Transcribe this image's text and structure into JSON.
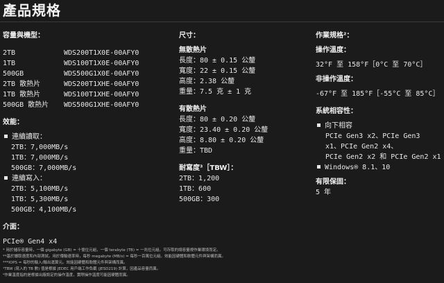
{
  "page_title": "產品規格",
  "capacity_model": {
    "heading": "容量與機型：",
    "rows": [
      {
        "capacity": "2TB",
        "model": "WDS200T1X0E-00AFY0"
      },
      {
        "capacity": "1TB",
        "model": "WDS100T1X0E-00AFY0"
      },
      {
        "capacity": "500GB",
        "model": "WDS500G1X0E-00AFY0"
      },
      {
        "capacity": "2TB 散熱片",
        "model": "WDS200T1XHE-00AFY0"
      },
      {
        "capacity": "1TB 散熱片",
        "model": "WDS100T1XHE-00AFY0"
      },
      {
        "capacity": "500GB 散熱片",
        "model": "WDS500G1XHE-00AFY0"
      }
    ]
  },
  "performance": {
    "heading": "效能：",
    "read_label": "連續讀取：",
    "read": [
      "2TB：7,000MB/s",
      "1TB：7,000MB/s",
      "500GB：7,000MB/s"
    ],
    "write_label": "連續寫入：",
    "write": [
      "2TB：5,100MB/s",
      "1TB：5,300MB/s",
      "500GB：4,100MB/s"
    ]
  },
  "interface": {
    "heading": "介面：",
    "value": "PCIe® Gen4 x4"
  },
  "dimensions": {
    "heading": "尺寸：",
    "no_heatsink_label": "無散熱片",
    "no_heatsink": [
      "長度：80 ± 0.15 公釐",
      "寬度：22 ± 0.15 公釐",
      "高度：2.38 公釐",
      "重量：7.5 克 ± 1 克"
    ],
    "heatsink_label": "有散熱片",
    "heatsink": [
      "長度：80 ± 0.20 公釐",
      "寬度：23.40 ± 0.20 公釐",
      "高度：8.80 ± 0.20 公釐",
      "重量：TBD"
    ]
  },
  "endurance": {
    "heading": "耐寫度³［TBW］：",
    "rows": [
      "2TB：1,200",
      "1TB：600",
      "500GB：300"
    ]
  },
  "operating": {
    "heading": "作業規格²：",
    "op_temp_label": "操作溫度：",
    "op_temp": "32°F 至 158°F［0°C 至 70°C］",
    "nonop_temp_label": "非操作溫度：",
    "nonop_temp": "-67°F 至 185°F［-55°C 至 85°C］"
  },
  "compatibility": {
    "heading": "系統相容性：",
    "backward_label": "向下相容",
    "backward_lines": [
      "PCIe Gen3 x2、PCIe Gen3",
      "x1、PCIe Gen2 x4、",
      "PCIe Gen2 x2 和 PCIe Gen2 x1"
    ],
    "windows": "Windows® 8.1、10"
  },
  "warranty": {
    "heading": "有限保固：",
    "value": "5 年"
  },
  "footnotes": [
    "* 用於儲存容量時，一個 gigabyte (GB) = 十億位元組，一個 terabyte (TB) = 一兆位元組。可存取的總容量視作業環境而定。",
    "**基於讀取速度和內部測試。用於傳輸速率時，每秒 megabyte (MB/s) = 每秒一百萬位元組。效能因硬體和軟體元件與架構而異。",
    "***IOPS = 每秒的輸入/輸出運算元。效能因硬體和軟體元件與架構而異。",
    "¹TBW (寫入的 TB 數) 值是根據 JEDEC 用戶端工作負載 (JESD219) 計算，因產品容量而異。",
    "²作業溫度指的是根據出廠設定的操作溫度，實際操作溫度可能因硬體而異。"
  ]
}
